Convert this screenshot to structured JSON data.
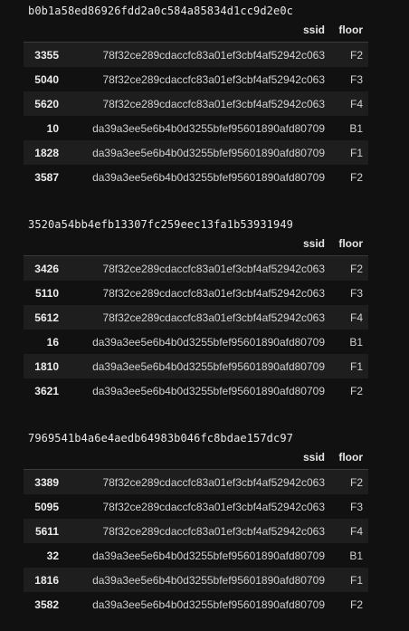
{
  "columns": {
    "index": "",
    "ssid": "ssid",
    "floor": "floor"
  },
  "blocks": [
    {
      "title": "b0b1a58ed86926fdd2a0c584a85834d1cc9d2e0c",
      "rows": [
        {
          "index": "3355",
          "ssid": "78f32ce289cdaccfc83a01ef3cbf4af52942c063",
          "floor": "F2"
        },
        {
          "index": "5040",
          "ssid": "78f32ce289cdaccfc83a01ef3cbf4af52942c063",
          "floor": "F3"
        },
        {
          "index": "5620",
          "ssid": "78f32ce289cdaccfc83a01ef3cbf4af52942c063",
          "floor": "F4"
        },
        {
          "index": "10",
          "ssid": "da39a3ee5e6b4b0d3255bfef95601890afd80709",
          "floor": "B1"
        },
        {
          "index": "1828",
          "ssid": "da39a3ee5e6b4b0d3255bfef95601890afd80709",
          "floor": "F1"
        },
        {
          "index": "3587",
          "ssid": "da39a3ee5e6b4b0d3255bfef95601890afd80709",
          "floor": "F2"
        }
      ]
    },
    {
      "title": "3520a54bb4efb13307fc259eec13fa1b53931949",
      "rows": [
        {
          "index": "3426",
          "ssid": "78f32ce289cdaccfc83a01ef3cbf4af52942c063",
          "floor": "F2"
        },
        {
          "index": "5110",
          "ssid": "78f32ce289cdaccfc83a01ef3cbf4af52942c063",
          "floor": "F3"
        },
        {
          "index": "5612",
          "ssid": "78f32ce289cdaccfc83a01ef3cbf4af52942c063",
          "floor": "F4"
        },
        {
          "index": "16",
          "ssid": "da39a3ee5e6b4b0d3255bfef95601890afd80709",
          "floor": "B1"
        },
        {
          "index": "1810",
          "ssid": "da39a3ee5e6b4b0d3255bfef95601890afd80709",
          "floor": "F1"
        },
        {
          "index": "3621",
          "ssid": "da39a3ee5e6b4b0d3255bfef95601890afd80709",
          "floor": "F2"
        }
      ]
    },
    {
      "title": "7969541b4a6e4aedb64983b046fc8bdae157dc97",
      "rows": [
        {
          "index": "3389",
          "ssid": "78f32ce289cdaccfc83a01ef3cbf4af52942c063",
          "floor": "F2"
        },
        {
          "index": "5095",
          "ssid": "78f32ce289cdaccfc83a01ef3cbf4af52942c063",
          "floor": "F3"
        },
        {
          "index": "5611",
          "ssid": "78f32ce289cdaccfc83a01ef3cbf4af52942c063",
          "floor": "F4"
        },
        {
          "index": "32",
          "ssid": "da39a3ee5e6b4b0d3255bfef95601890afd80709",
          "floor": "B1"
        },
        {
          "index": "1816",
          "ssid": "da39a3ee5e6b4b0d3255bfef95601890afd80709",
          "floor": "F1"
        },
        {
          "index": "3582",
          "ssid": "da39a3ee5e6b4b0d3255bfef95601890afd80709",
          "floor": "F2"
        }
      ]
    }
  ]
}
